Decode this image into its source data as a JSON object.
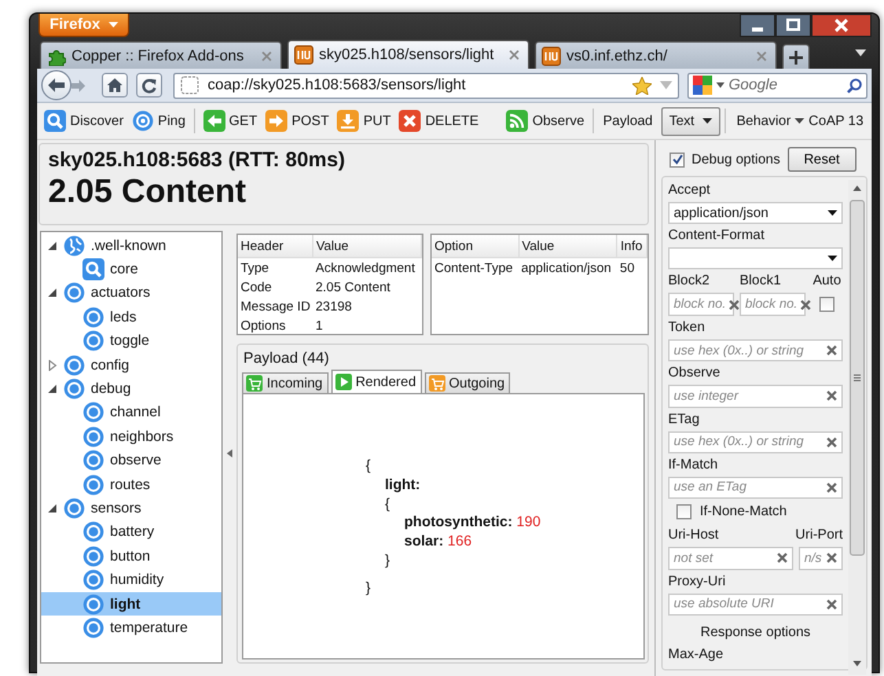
{
  "browser": {
    "app_button": "Firefox",
    "tabs": [
      {
        "title": "Copper :: Firefox Add-ons",
        "kind": "addons",
        "selected": false
      },
      {
        "title": "sky025.h108/sensors/light",
        "kind": "copper",
        "selected": true
      },
      {
        "title": "vs0.inf.ethz.ch/",
        "kind": "copper",
        "selected": false
      }
    ],
    "url": "coap://sky025.h108:5683/sensors/light",
    "search": {
      "placeholder": "Google"
    }
  },
  "toolbar": [
    {
      "kind": "discover",
      "label": "Discover"
    },
    {
      "kind": "ping",
      "label": "Ping"
    },
    {
      "kind": "separator"
    },
    {
      "kind": "get",
      "label": "GET"
    },
    {
      "kind": "post",
      "label": "POST"
    },
    {
      "kind": "put",
      "label": "PUT"
    },
    {
      "kind": "delete",
      "label": "DELETE"
    },
    {
      "kind": "observe",
      "label": "Observe"
    },
    {
      "kind": "separator"
    },
    {
      "kind": "label",
      "label": "Payload"
    },
    {
      "kind": "dropdown",
      "label": "Text"
    },
    {
      "kind": "separator"
    },
    {
      "kind": "menu",
      "label": "Behavior"
    },
    {
      "kind": "version",
      "label": "CoAP 13"
    }
  ],
  "status": {
    "endpoint": "sky025.h108:5683 (RTT: 80ms)",
    "code": "2.05 Content"
  },
  "tree": [
    {
      "label": ".well-known",
      "kind": "globe",
      "expanded": true,
      "selected": false,
      "children": [
        {
          "label": "core",
          "kind": "search",
          "selected": false
        }
      ]
    },
    {
      "label": "actuators",
      "kind": "resource",
      "expanded": true,
      "selected": false,
      "children": [
        {
          "label": "leds",
          "kind": "resource",
          "selected": false
        },
        {
          "label": "toggle",
          "kind": "resource",
          "selected": false
        }
      ]
    },
    {
      "label": "config",
      "kind": "resource",
      "expanded": false,
      "selected": false
    },
    {
      "label": "debug",
      "kind": "resource",
      "expanded": true,
      "selected": false,
      "children": [
        {
          "label": "channel",
          "kind": "resource",
          "selected": false
        },
        {
          "label": "neighbors",
          "kind": "resource",
          "selected": false
        },
        {
          "label": "observe",
          "kind": "resource",
          "selected": false
        },
        {
          "label": "routes",
          "kind": "resource",
          "selected": false
        }
      ]
    },
    {
      "label": "sensors",
      "kind": "resource",
      "expanded": true,
      "selected": false,
      "children": [
        {
          "label": "battery",
          "kind": "resource",
          "selected": false
        },
        {
          "label": "button",
          "kind": "resource",
          "selected": false
        },
        {
          "label": "humidity",
          "kind": "resource",
          "selected": false
        },
        {
          "label": "light",
          "kind": "resource",
          "selected": true
        },
        {
          "label": "temperature",
          "kind": "resource",
          "selected": false
        }
      ]
    }
  ],
  "header_table": {
    "columns": [
      "Header",
      "Value"
    ],
    "rows": [
      [
        "Type",
        "Acknowledgment"
      ],
      [
        "Code",
        "2.05 Content"
      ],
      [
        "Message ID",
        "23198"
      ],
      [
        "Options",
        "1"
      ]
    ]
  },
  "options_table": {
    "columns": [
      "Option",
      "Value",
      "Info"
    ],
    "rows": [
      [
        "Content-Type",
        "application/json",
        "50"
      ]
    ]
  },
  "payload": {
    "title": "Payload (44)",
    "tabs": [
      {
        "label": "Incoming",
        "kind": "incoming",
        "selected": false
      },
      {
        "label": "Rendered",
        "kind": "rendered",
        "selected": true
      },
      {
        "label": "Outgoing",
        "kind": "outgoing",
        "selected": false
      }
    ],
    "rendered": {
      "open": "{",
      "entries": [
        {
          "key": "light:",
          "open": "{",
          "entries": [
            {
              "key": "photosynthetic:",
              "value": "190"
            },
            {
              "key": "solar:",
              "value": "166"
            }
          ],
          "close": "}"
        }
      ],
      "close": "}"
    }
  },
  "debug": {
    "enabled": {
      "label": "Debug options",
      "checked": true
    },
    "reset": "Reset",
    "fields": [
      {
        "kind": "select",
        "label": "Accept",
        "value": "application/json"
      },
      {
        "kind": "select",
        "label": "Content-Format"
      },
      {
        "kind": "inputs",
        "items": [
          {
            "label": "Block2",
            "placeholder": "block no."
          },
          {
            "label": "Block1",
            "placeholder": "block no."
          }
        ],
        "check": {
          "label": "Auto",
          "checked": false
        }
      },
      {
        "kind": "input",
        "label": "Token",
        "placeholder": "use hex (0x..) or string"
      },
      {
        "kind": "input",
        "label": "Observe",
        "placeholder": "use integer"
      },
      {
        "kind": "input",
        "label": "ETag",
        "placeholder": "use hex (0x..) or string"
      },
      {
        "kind": "input",
        "label": "If-Match",
        "placeholder": "use an ETag"
      },
      {
        "kind": "check",
        "label": "If-None-Match",
        "checked": false
      },
      {
        "kind": "inputs",
        "items": [
          {
            "label": "Uri-Host",
            "placeholder": "not set"
          },
          {
            "label": "Uri-Port",
            "placeholder": "n/s"
          }
        ]
      },
      {
        "kind": "input",
        "label": "Proxy-Uri",
        "placeholder": "use absolute URI"
      },
      {
        "kind": "section",
        "label": "Response options"
      },
      {
        "kind": "caption",
        "label": "Max-Age"
      }
    ]
  }
}
